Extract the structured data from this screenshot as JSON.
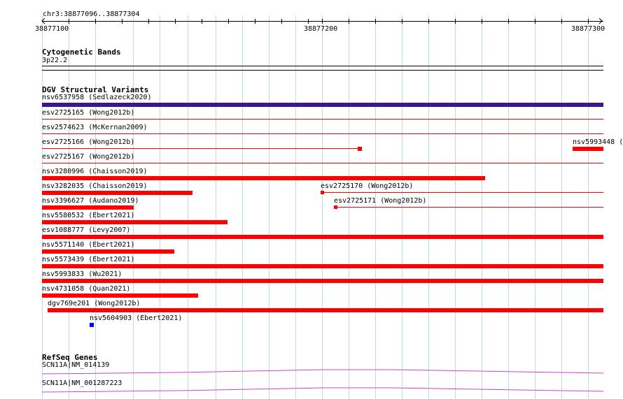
{
  "ruler": {
    "position": "chr3:38877096..38877304",
    "ticks": [
      "38877100",
      "38877200",
      "38877300"
    ]
  },
  "cytoband": {
    "title": "Cytogenetic Bands",
    "band": "3p22.2"
  },
  "dgv": {
    "title": "DGV Structural Variants",
    "items": [
      {
        "label": "nsv6537958 (Sedlazeck2020)"
      },
      {
        "label": "esv2725165 (Wong2012b)"
      },
      {
        "label": "esv2574623 (McKernan2009)"
      },
      {
        "label": "esv2725166 (Wong2012b)"
      },
      {
        "label": "nsv5993448 (",
        "truncated": true
      },
      {
        "label": "esv2725167 (Wong2012b)"
      },
      {
        "label": "nsv3280996 (Chaisson2019)"
      },
      {
        "label": "nsv3282035 (Chaisson2019)"
      },
      {
        "label": "esv2725170 (Wong2012b)"
      },
      {
        "label": "nsv3396627 (Audano2019)"
      },
      {
        "label": "esv2725171 (Wong2012b)"
      },
      {
        "label": "nsv5580532 (Ebert2021)"
      },
      {
        "label": "esv1088777 (Levy2007)"
      },
      {
        "label": "nsv5571140 (Ebert2021)"
      },
      {
        "label": "nsv5573439 (Ebert2021)"
      },
      {
        "label": "nsv5993833 (Wu2021)"
      },
      {
        "label": "nsv4731058 (Quan2021)"
      },
      {
        "label": "dgv769e201 (Wong2012b)"
      },
      {
        "label": "nsv5604903 (Ebert2021)"
      }
    ]
  },
  "refseq": {
    "title": "RefSeq Genes",
    "genes": [
      {
        "label": "SCN11A|NM_014139"
      },
      {
        "label": "SCN11A|NM_001287223"
      }
    ]
  },
  "colors": {
    "grid": "#b7dcef",
    "variant_red": "#ff0000",
    "variant_purple": "#3b1690",
    "variant_blue": "#0000ff",
    "gene": "#cc44cc"
  }
}
